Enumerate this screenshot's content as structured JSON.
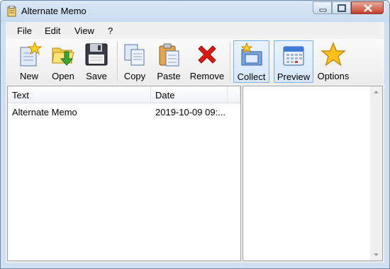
{
  "window": {
    "title": "Alternate Memo"
  },
  "menu": [
    "File",
    "Edit",
    "View",
    "?"
  ],
  "toolbar": {
    "buttons": [
      {
        "label": "New",
        "icon": "new-memo-icon"
      },
      {
        "label": "Open",
        "icon": "open-folder-icon"
      },
      {
        "label": "Save",
        "icon": "floppy-disk-icon"
      },
      {
        "label": "Copy",
        "icon": "copy-icon"
      },
      {
        "label": "Paste",
        "icon": "paste-clipboard-icon"
      },
      {
        "label": "Remove",
        "icon": "red-x-icon"
      },
      {
        "label": "Collect",
        "icon": "collect-folder-icon"
      },
      {
        "label": "Preview",
        "icon": "preview-calendar-icon"
      },
      {
        "label": "Options",
        "icon": "star-icon"
      }
    ]
  },
  "list": {
    "columns": [
      "Text",
      "Date"
    ],
    "rows": [
      {
        "text": "Alternate Memo",
        "date": "2019-10-09 09:..."
      }
    ]
  },
  "colors": {
    "titlebar": "#c7dbef",
    "accent": "#7faee0",
    "close": "#c7412a"
  }
}
